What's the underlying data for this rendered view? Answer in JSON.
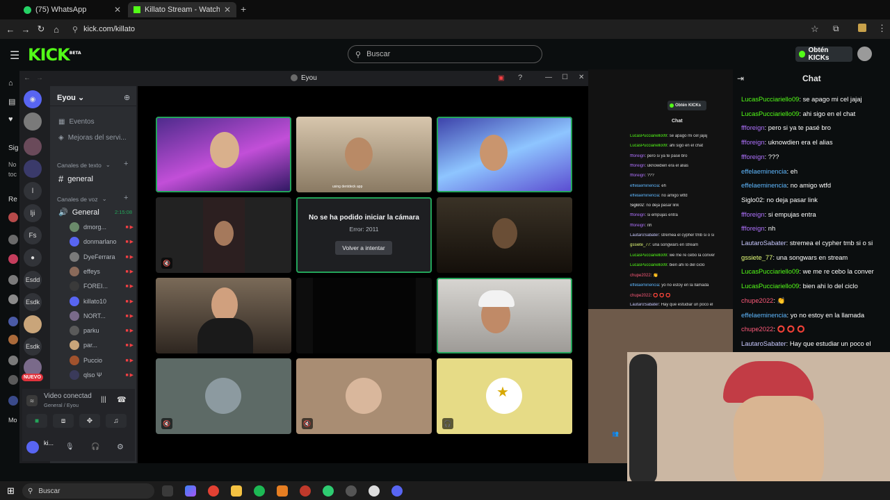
{
  "browser": {
    "tabs": [
      {
        "label": "(75) WhatsApp",
        "active": false
      },
      {
        "label": "Killato Stream - Watch Live on",
        "active": true
      }
    ],
    "url": "kick.com/killato"
  },
  "kick": {
    "logo": "KICK",
    "logo_badge": "BETA",
    "search_placeholder": "Buscar",
    "obtain_kicks": "Obtén KICKs",
    "chat_title": "Chat",
    "accent": "#53fc18",
    "left_labels": [
      "Sig",
      "No",
      "toc",
      "Re",
      "Mo"
    ],
    "new_badge": "NUEVO"
  },
  "discord": {
    "window_title": "Eyou",
    "server_name": "Eyou",
    "server_icons": [
      "l",
      "lji",
      "Fs",
      "Esdd",
      "Esdk",
      "Esdk"
    ],
    "sidebar_items": [
      "Eventos",
      "Mejoras del servi..."
    ],
    "text_category": "Canales de texto",
    "text_channel": "general",
    "voice_category": "Canales de voz",
    "voice_channel": "General",
    "voice_timer": "2:15:08",
    "voice_users": [
      "dmorg...",
      "donmarlano",
      "DyeFerrara",
      "effeys",
      "FOREI...",
      "killato10",
      "NORT...",
      "parku",
      "par...",
      "Puccio",
      "qlso Ψ"
    ],
    "connection_status": "Video conectad",
    "connection_location": "General / Eyou",
    "user_name": "ki...",
    "camera_error_title": "No se ha podido iniciar la cámara",
    "camera_error_code": "Error: 2011",
    "retry_button": "Volver a intentar",
    "tile_overlay_text": "using dentdeck app",
    "speaking_color": "#23a55a"
  },
  "chat": [
    {
      "user": "LucasPucciariello09",
      "msg": "se apago mi cel jajaj",
      "color": "#53fc18"
    },
    {
      "user": "LucasPucciariello09",
      "msg": "ahi sigo en el chat",
      "color": "#53fc18"
    },
    {
      "user": "ffforeign",
      "msg": "pero si ya te pasé bro",
      "color": "#b072ff"
    },
    {
      "user": "ffforeign",
      "msg": "uknowdien era el alias",
      "color": "#b072ff"
    },
    {
      "user": "ffforeign",
      "msg": "???",
      "color": "#b072ff"
    },
    {
      "user": "effelaeminencia",
      "msg": "eh",
      "color": "#5fb8ff"
    },
    {
      "user": "effelaeminencia",
      "msg": "no amigo wtfd",
      "color": "#5fb8ff"
    },
    {
      "user": "Siglo02",
      "msg": "no deja pasar link",
      "color": "#ffffff"
    },
    {
      "user": "ffforeign",
      "msg": "si empujas entra",
      "color": "#b072ff"
    },
    {
      "user": "ffforeign",
      "msg": "nh",
      "color": "#b072ff"
    },
    {
      "user": "LautaroSabater",
      "msg": "stremea el cypher tmb si o si",
      "color": "#c9c9ff"
    },
    {
      "user": "gssiete_77",
      "msg": "una songwars en stream",
      "color": "#e6ff7a"
    },
    {
      "user": "LucasPucciariello09",
      "msg": "we me re cebo la conver",
      "color": "#53fc18"
    },
    {
      "user": "LucasPucciariello09",
      "msg": "bien ahi lo del ciclo",
      "color": "#53fc18"
    },
    {
      "user": "chupe2022",
      "msg": "👏",
      "color": "#ff5a7a"
    },
    {
      "user": "effelaeminencia",
      "msg": "yo no estoy en la llamada",
      "color": "#5fb8ff"
    },
    {
      "user": "chupe2022",
      "msg": "⭕ ⭕ ⭕",
      "color": "#ff5a7a"
    },
    {
      "user": "LautaroSabater",
      "msg": "Hay que estudiar un poco el",
      "color": "#c9c9ff"
    }
  ],
  "mini_chat": {
    "obtain_kicks": "Obtén KICKs",
    "chat_title": "Chat"
  },
  "taskbar": {
    "search_placeholder": "Buscar"
  }
}
